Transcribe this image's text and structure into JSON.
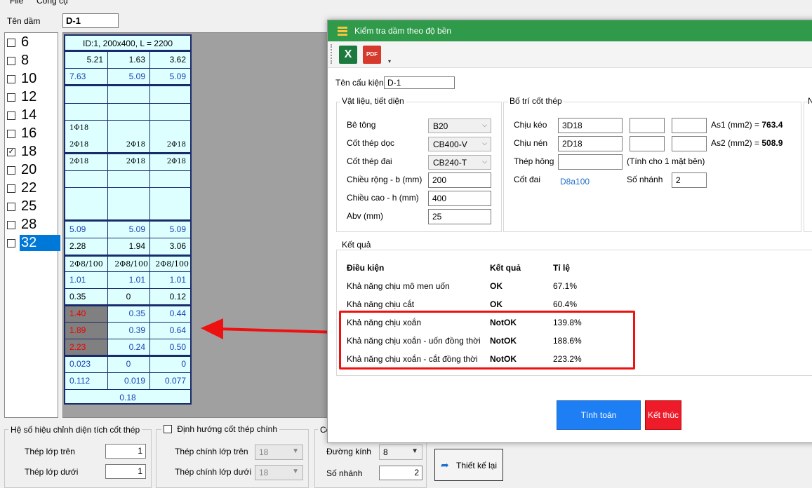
{
  "menu": {
    "file": "File",
    "tools": "Công cụ"
  },
  "beam_name": {
    "label": "Tên dầm",
    "value": "D-1"
  },
  "diameters": [
    {
      "label": "6",
      "checked": false
    },
    {
      "label": "8",
      "checked": false
    },
    {
      "label": "10",
      "checked": false
    },
    {
      "label": "12",
      "checked": false
    },
    {
      "label": "14",
      "checked": false
    },
    {
      "label": "16",
      "checked": false
    },
    {
      "label": "18",
      "checked": true
    },
    {
      "label": "20",
      "checked": false
    },
    {
      "label": "22",
      "checked": false
    },
    {
      "label": "25",
      "checked": false
    },
    {
      "label": "28",
      "checked": false
    },
    {
      "label": "32",
      "checked": false,
      "selected": true
    }
  ],
  "beam_table": {
    "header": "ID:1, 200x400, L = 2200",
    "row1": [
      "5.21",
      "1.63",
      "3.62"
    ],
    "row2": [
      "7.63",
      "5.09",
      "5.09"
    ],
    "bar_top": "1Φ18",
    "bars_a": [
      "2Φ18",
      "2Φ18",
      "2Φ18"
    ],
    "bars_b": [
      "2Φ18",
      "2Φ18",
      "2Φ18"
    ],
    "row_as": [
      "5.09",
      "5.09",
      "5.09"
    ],
    "row_c": [
      "2.28",
      "1.94",
      "3.06"
    ],
    "stirrups": [
      "2Φ8/100",
      "2Φ8/100",
      "2Φ8/100"
    ],
    "row_d": [
      "1.01",
      "1.01",
      "1.01"
    ],
    "row_e": [
      "0.35",
      "0",
      "0.12"
    ],
    "row_f": [
      "1.40",
      "0.35",
      "0.44"
    ],
    "row_g": [
      "1.89",
      "0.39",
      "0.64"
    ],
    "row_h": [
      "2.23",
      "0.24",
      "0.50"
    ],
    "row_i": [
      "0.023",
      "0",
      "0"
    ],
    "row_j": [
      "0.112",
      "0.019",
      "0.077"
    ],
    "row_k": "0.18"
  },
  "adjust_panel": {
    "title": "Hệ số hiệu chỉnh diện tích cốt thép",
    "top_label": "Thép lớp trên",
    "top_value": "1",
    "bottom_label": "Thép lớp dưới",
    "bottom_value": "1"
  },
  "orient_panel": {
    "title": "Định hướng cốt thép chính",
    "top_label": "Thép chính lớp trên",
    "top_value": "18",
    "bottom_label": "Thép chính lớp dưới",
    "bottom_value": "18"
  },
  "stirrup_panel": {
    "title": "Cố",
    "dia_label": "Đường kính",
    "dia_value": "8",
    "legs_label": "Số nhánh",
    "legs_value": "2"
  },
  "redesign_button": "Thiết kế lại",
  "dialog": {
    "title": "Kiểm tra dầm theo độ bền",
    "toolbar": {
      "excel": "X",
      "pdf": "PDF"
    },
    "member_label": "Tên cấu kiện",
    "member_value": "D-1",
    "material": {
      "title": "Vật liệu, tiết diện",
      "concrete_label": "Bê tông",
      "concrete_value": "B20",
      "long_steel_label": "Cốt thép dọc",
      "long_steel_value": "CB400-V",
      "stirrup_steel_label": "Cốt thép đai",
      "stirrup_steel_value": "CB240-T",
      "width_label": "Chiều rộng - b (mm)",
      "width_value": "200",
      "height_label": "Chiều cao - h (mm)",
      "height_value": "400",
      "abv_label": "Abv (mm)",
      "abv_value": "25"
    },
    "rebar": {
      "title": "Bố trí cốt thép",
      "tension_label": "Chịu kéo",
      "tension_value": "3D18",
      "compression_label": "Chịu nén",
      "compression_value": "2D18",
      "as1_label": "As1 (mm2) =",
      "as1_value": "763.4",
      "as2_label": "As2 (mm2) =",
      "as2_value": "508.9",
      "side_label": "Thép hông",
      "side_value": "",
      "side_note": "(Tính cho 1 mặt bên)",
      "stirrup_label": "Cốt đai",
      "stirrup_value": "D8a100",
      "legs_label": "Số nhánh",
      "legs_value": "2"
    },
    "partial_title": "N",
    "results": {
      "title": "Kết quả",
      "headers": [
        "Điều kiện",
        "Kết quả",
        "Tỉ lệ"
      ],
      "rows": [
        {
          "condition": "Khả năng chịu mô men uốn",
          "result": "OK",
          "ratio": "67.1%"
        },
        {
          "condition": "Khả năng chịu cắt",
          "result": "OK",
          "ratio": "60.4%"
        },
        {
          "condition": "Khả năng chịu xoắn",
          "result": "NotOK",
          "ratio": "139.8%"
        },
        {
          "condition": "Khả năng chịu xoắn - uốn đồng thời",
          "result": "NotOK",
          "ratio": "188.6%"
        },
        {
          "condition": "Khả năng chịu xoắn - cắt đồng thời",
          "result": "NotOK",
          "ratio": "223.2%"
        }
      ]
    },
    "calc_button": "Tính toán",
    "exit_button": "Kết thúc"
  },
  "colors": {
    "accent_green": "#2e9a4a",
    "button_blue": "#1e7ff5",
    "button_red": "#ee1c2a",
    "highlight_red": "#ee1111",
    "beam_blue": "#1a3fb5"
  }
}
